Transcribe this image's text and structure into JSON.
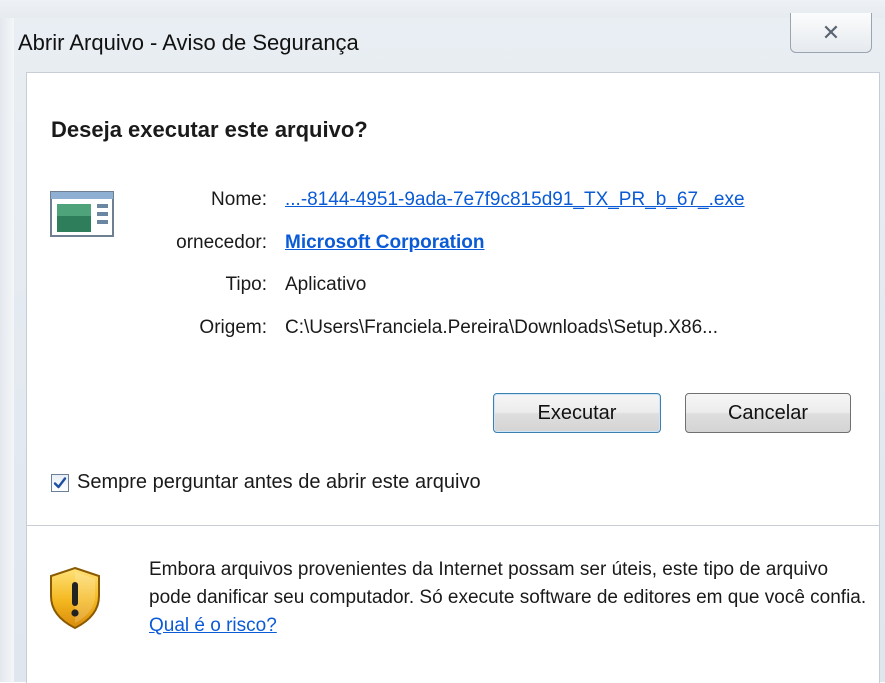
{
  "window": {
    "title": "Abrir Arquivo - Aviso de Segurança",
    "close_glyph": "✕"
  },
  "dialog": {
    "heading": "Deseja executar este arquivo?",
    "icon": "application-icon",
    "fields": {
      "name_label": "Nome:",
      "name_value": "...-8144-4951-9ada-7e7f9c815d91_TX_PR_b_67_.exe",
      "publisher_label": "ornecedor:",
      "publisher_value": "Microsoft Corporation",
      "type_label": "Tipo:",
      "type_value": "Aplicativo",
      "origin_label": "Origem:",
      "origin_value": "C:\\Users\\Franciela.Pereira\\Downloads\\Setup.X86..."
    },
    "buttons": {
      "run": "Executar",
      "cancel": "Cancelar"
    },
    "checkbox": {
      "label": "Sempre perguntar antes de abrir este arquivo",
      "checked": true
    },
    "warning": {
      "icon": "shield-warning-icon",
      "text": "Embora arquivos provenientes da Internet possam ser úteis, este tipo de arquivo pode danificar seu computador. Só execute software de editores em que você confia.",
      "link": "Qual é o risco?"
    }
  },
  "colors": {
    "link": "#0b5bd6",
    "frame": "#e3e9ef"
  }
}
